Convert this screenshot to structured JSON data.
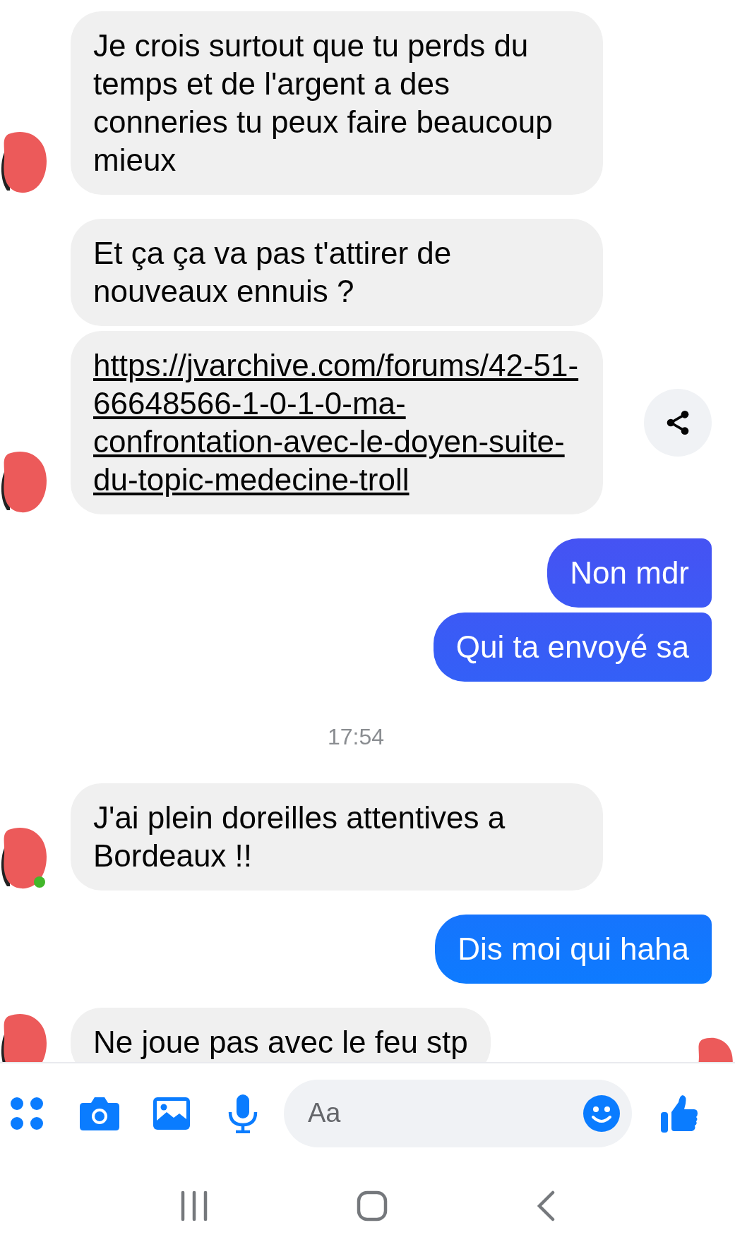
{
  "messages": [
    {
      "kind": "received",
      "text": "Je crois surtout que tu perds du temps et de l'argent a des conneries tu peux faire beaucoup mieux",
      "avatar": true,
      "online": false
    },
    {
      "kind": "received",
      "text": "Et ça ça va pas t'attirer de nouveaux ennuis ?",
      "avatar": false
    },
    {
      "kind": "link",
      "text": "https://jvarchive.com/forums/42-51-66648566-1-0-1-0-ma-confrontation-avec-le-doyen-suite-du-topic-medecine-troll",
      "avatar": true,
      "online": false
    },
    {
      "kind": "sent",
      "text": "Non mdr"
    },
    {
      "kind": "sent",
      "text": "Qui ta envoyé sa"
    },
    {
      "kind": "timestamp",
      "text": "17:54"
    },
    {
      "kind": "received",
      "text": "J'ai plein doreilles attentives a Bordeaux !!",
      "avatar": true,
      "online": true
    },
    {
      "kind": "sent",
      "text": "Dis moi qui haha"
    },
    {
      "kind": "received",
      "text": "Ne joue pas avec le feu stp",
      "avatar": true,
      "online": false,
      "seen": true
    }
  ],
  "composer": {
    "placeholder": "Aa"
  }
}
